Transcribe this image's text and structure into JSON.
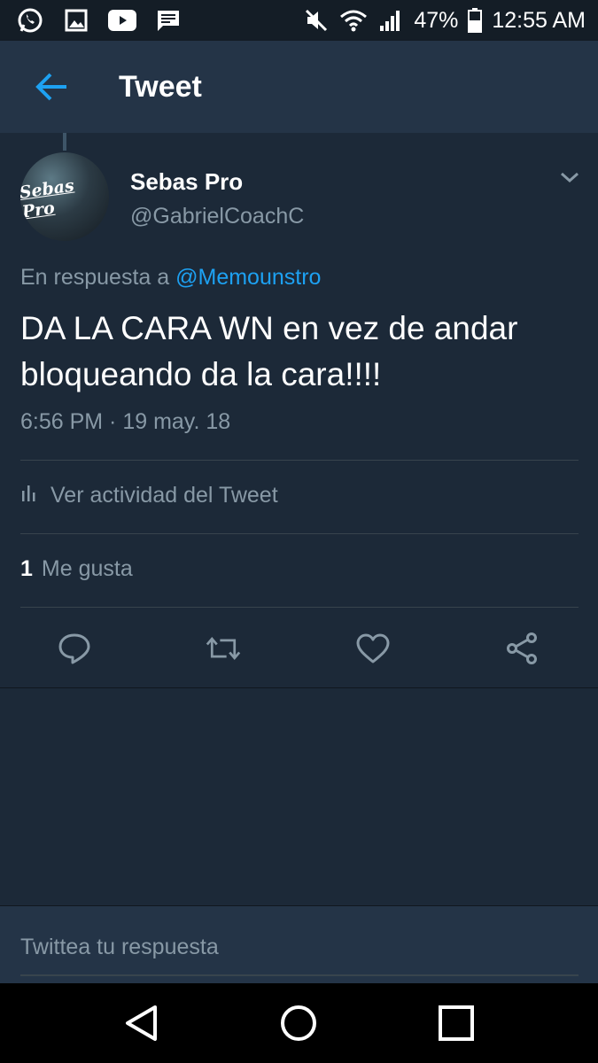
{
  "status_bar": {
    "battery": "47%",
    "time": "12:55 AM"
  },
  "header": {
    "title": "Tweet"
  },
  "tweet": {
    "avatar_text": "Sebas Pro",
    "name": "Sebas Pro",
    "handle": "@GabrielCoachC",
    "reply_prefix": "En respuesta a",
    "reply_mention": "@Memounstro",
    "text": "DA LA CARA WN en vez de andar bloqueando da la cara!!!!",
    "timestamp": "6:56 PM · 19 may. 18",
    "activity_label": "Ver actividad del Tweet",
    "likes_count": "1",
    "likes_label": "Me gusta"
  },
  "reply": {
    "placeholder": "Twittea tu respuesta"
  },
  "colors": {
    "background": "#1c2938",
    "header": "#243447",
    "accent": "#1da1f2",
    "muted": "#8899a6"
  },
  "icons": [
    "whatsapp-icon",
    "gallery-icon",
    "youtube-icon",
    "message-icon",
    "mute-icon",
    "wifi-icon",
    "signal-icon",
    "battery-icon",
    "back-arrow-icon",
    "chevron-down-icon",
    "activity-icon",
    "reply-icon",
    "retweet-icon",
    "like-icon",
    "share-icon",
    "nav-back-icon",
    "nav-home-icon",
    "nav-recents-icon"
  ]
}
